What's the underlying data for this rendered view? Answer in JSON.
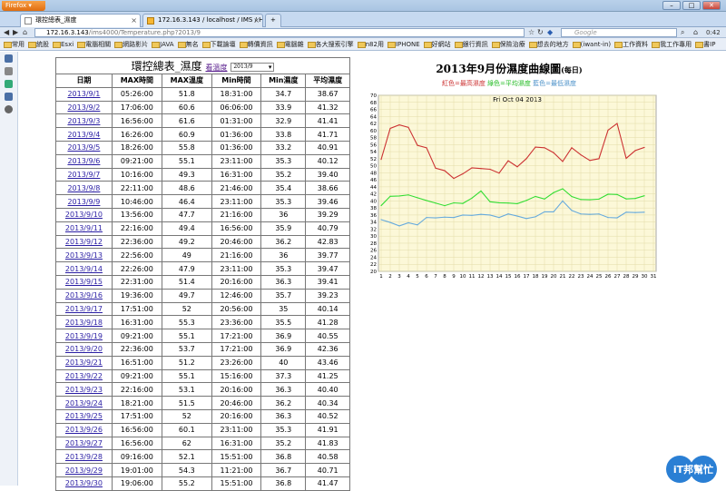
{
  "browser": {
    "menu_label": "Firefox",
    "tabs": [
      {
        "label": "環控總表_濕度",
        "active": true
      },
      {
        "label": "172.16.3.143 / localhost / IMS / Hu...",
        "active": false
      }
    ],
    "new_tab": "+",
    "url_domain": "172.16.3.143",
    "url_path": "/ims4000/Temperature.php?2013/9",
    "search_placeholder": "Google",
    "clock": "0:42",
    "bookmarks": [
      "常用",
      "統股",
      "Esxi",
      "電腦相關",
      "網路影片",
      "JAVA",
      "無名",
      "下載論壇",
      "轉價資訊",
      "電腦雜",
      "各大搜索引擎",
      "n82用",
      "IPHONE",
      "好網站",
      "銀行資訊",
      "保險治療",
      "想去的地方",
      "(iwant-in)",
      "工作資料",
      "我工作專用",
      "書IP"
    ]
  },
  "table": {
    "title": "環控總表_濕度",
    "switch_link": "看溫度",
    "month_select": "2013/9",
    "headers": [
      "日期",
      "MAX時間",
      "MAX溫度",
      "Min時間",
      "Min濕度",
      "平均濕度"
    ],
    "rows": [
      [
        "2013/9/1",
        "05:26:00",
        "51.8",
        "18:31:00",
        "34.7",
        "38.67"
      ],
      [
        "2013/9/2",
        "17:06:00",
        "60.6",
        "06:06:00",
        "33.9",
        "41.32"
      ],
      [
        "2013/9/3",
        "16:56:00",
        "61.6",
        "01:31:00",
        "32.9",
        "41.41"
      ],
      [
        "2013/9/4",
        "16:26:00",
        "60.9",
        "01:36:00",
        "33.8",
        "41.71"
      ],
      [
        "2013/9/5",
        "18:26:00",
        "55.8",
        "01:36:00",
        "33.2",
        "40.91"
      ],
      [
        "2013/9/6",
        "09:21:00",
        "55.1",
        "23:11:00",
        "35.3",
        "40.12"
      ],
      [
        "2013/9/7",
        "10:16:00",
        "49.3",
        "16:31:00",
        "35.2",
        "39.40"
      ],
      [
        "2013/9/8",
        "22:11:00",
        "48.6",
        "21:46:00",
        "35.4",
        "38.66"
      ],
      [
        "2013/9/9",
        "10:46:00",
        "46.4",
        "23:11:00",
        "35.3",
        "39.46"
      ],
      [
        "2013/9/10",
        "13:56:00",
        "47.7",
        "21:16:00",
        "36",
        "39.29"
      ],
      [
        "2013/9/11",
        "22:16:00",
        "49.4",
        "16:56:00",
        "35.9",
        "40.79"
      ],
      [
        "2013/9/12",
        "22:36:00",
        "49.2",
        "20:46:00",
        "36.2",
        "42.83"
      ],
      [
        "2013/9/13",
        "22:56:00",
        "49",
        "21:16:00",
        "36",
        "39.77"
      ],
      [
        "2013/9/14",
        "22:26:00",
        "47.9",
        "23:11:00",
        "35.3",
        "39.47"
      ],
      [
        "2013/9/15",
        "22:31:00",
        "51.4",
        "20:16:00",
        "36.3",
        "39.41"
      ],
      [
        "2013/9/16",
        "19:36:00",
        "49.7",
        "12:46:00",
        "35.7",
        "39.23"
      ],
      [
        "2013/9/17",
        "17:51:00",
        "52",
        "20:56:00",
        "35",
        "40.14"
      ],
      [
        "2013/9/18",
        "16:31:00",
        "55.3",
        "23:36:00",
        "35.5",
        "41.28"
      ],
      [
        "2013/9/19",
        "09:21:00",
        "55.1",
        "17:21:00",
        "36.9",
        "40.55"
      ],
      [
        "2013/9/20",
        "22:36:00",
        "53.7",
        "17:21:00",
        "36.9",
        "42.36"
      ],
      [
        "2013/9/21",
        "16:51:00",
        "51.2",
        "23:26:00",
        "40",
        "43.46"
      ],
      [
        "2013/9/22",
        "09:21:00",
        "55.1",
        "15:16:00",
        "37.3",
        "41.25"
      ],
      [
        "2013/9/23",
        "22:16:00",
        "53.1",
        "20:16:00",
        "36.3",
        "40.40"
      ],
      [
        "2013/9/24",
        "18:21:00",
        "51.5",
        "20:46:00",
        "36.2",
        "40.34"
      ],
      [
        "2013/9/25",
        "17:51:00",
        "52",
        "20:16:00",
        "36.3",
        "40.52"
      ],
      [
        "2013/9/26",
        "16:56:00",
        "60.1",
        "23:11:00",
        "35.3",
        "41.91"
      ],
      [
        "2013/9/27",
        "16:56:00",
        "62",
        "16:31:00",
        "35.2",
        "41.83"
      ],
      [
        "2013/9/28",
        "09:16:00",
        "52.1",
        "15:51:00",
        "36.8",
        "40.58"
      ],
      [
        "2013/9/29",
        "19:01:00",
        "54.3",
        "11:21:00",
        "36.7",
        "40.71"
      ],
      [
        "2013/9/30",
        "19:06:00",
        "55.2",
        "15:51:00",
        "36.8",
        "41.47"
      ]
    ]
  },
  "chart_header": {
    "title_main": "2013年9月份濕度曲線圖",
    "title_small": "(每日)",
    "legend_red": "紅色=最高濕度",
    "legend_green": "綠色=平均濕度",
    "legend_blue": "藍色=最低濕度",
    "colors": {
      "max": "#cc3333",
      "avg": "#33dd33",
      "min": "#66aadd"
    }
  },
  "chart_data": {
    "type": "line",
    "title": "Fri Oct 04 2013",
    "x": [
      1,
      2,
      3,
      4,
      5,
      6,
      7,
      8,
      9,
      10,
      11,
      12,
      13,
      14,
      15,
      16,
      17,
      18,
      19,
      20,
      21,
      22,
      23,
      24,
      25,
      26,
      27,
      28,
      29,
      30,
      31
    ],
    "ylim": [
      20,
      70
    ],
    "yticks": [
      20,
      22,
      24,
      26,
      28,
      30,
      32,
      34,
      36,
      38,
      40,
      42,
      44,
      46,
      48,
      50,
      52,
      54,
      56,
      58,
      60,
      62,
      64,
      66,
      68,
      70
    ],
    "grid": true,
    "series": [
      {
        "name": "紅色=最高濕度",
        "color": "#cc3333",
        "values": [
          51.8,
          60.6,
          61.6,
          60.9,
          55.8,
          55.1,
          49.3,
          48.6,
          46.4,
          47.7,
          49.4,
          49.2,
          49,
          47.9,
          51.4,
          49.7,
          52,
          55.3,
          55.1,
          53.7,
          51.2,
          55.1,
          53.1,
          51.5,
          52,
          60.1,
          62,
          52.1,
          54.3,
          55.2
        ]
      },
      {
        "name": "綠色=平均濕度",
        "color": "#33dd33",
        "values": [
          38.67,
          41.32,
          41.41,
          41.71,
          40.91,
          40.12,
          39.4,
          38.66,
          39.46,
          39.29,
          40.79,
          42.83,
          39.77,
          39.47,
          39.41,
          39.23,
          40.14,
          41.28,
          40.55,
          42.36,
          43.46,
          41.25,
          40.4,
          40.34,
          40.52,
          41.91,
          41.83,
          40.58,
          40.71,
          41.47
        ]
      },
      {
        "name": "藍色=最低濕度",
        "color": "#66aadd",
        "values": [
          34.7,
          33.9,
          32.9,
          33.8,
          33.2,
          35.3,
          35.2,
          35.4,
          35.3,
          36,
          35.9,
          36.2,
          36,
          35.3,
          36.3,
          35.7,
          35,
          35.5,
          36.9,
          36.9,
          40,
          37.3,
          36.3,
          36.2,
          36.3,
          35.3,
          35.2,
          36.8,
          36.7,
          36.8
        ]
      }
    ]
  },
  "watermark": "iT邦幫忙"
}
